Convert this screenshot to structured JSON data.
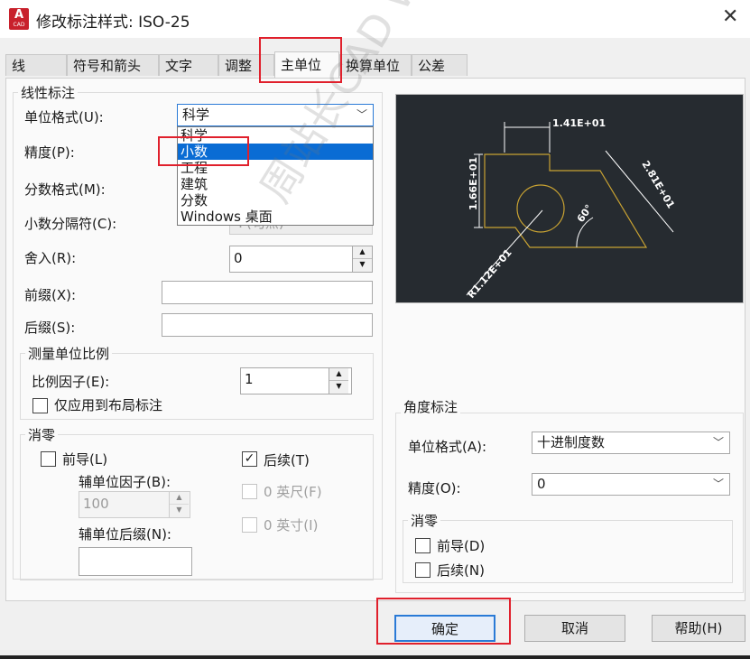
{
  "window": {
    "title": "修改标注样式: ISO-25",
    "app_icon_letter": "A",
    "app_icon_sub": "CAD",
    "close_glyph": "✕"
  },
  "tabs": [
    {
      "label": "线"
    },
    {
      "label": "符号和箭头"
    },
    {
      "label": "文字"
    },
    {
      "label": "调整"
    },
    {
      "label": "主单位"
    },
    {
      "label": "换算单位"
    },
    {
      "label": "公差"
    }
  ],
  "linear": {
    "legend": "线性标注",
    "unit_format_label": "单位格式(U):",
    "unit_format_value": "科学",
    "precision_label": "精度(P):",
    "fraction_label": "分数格式(M):",
    "decimal_sep_label": "小数分隔符(C):",
    "decimal_sep_value": "'.'(句点)",
    "round_label": "舍入(R):",
    "round_value": "0",
    "prefix_label": "前缀(X):",
    "prefix_value": "",
    "suffix_label": "后缀(S):",
    "suffix_value": ""
  },
  "dropdown": {
    "options": [
      "科学",
      "小数",
      "工程",
      "建筑",
      "分数",
      "Windows 桌面"
    ],
    "selected": "小数"
  },
  "scale": {
    "legend": "测量单位比例",
    "factor_label": "比例因子(E):",
    "factor_value": "1",
    "layout_only_label": "仅应用到布局标注"
  },
  "zero_linear": {
    "legend": "消零",
    "leading_label": "前导(L)",
    "trailing_label": "后续(T)",
    "trailing_checked": "✓",
    "sub_factor_label": "辅单位因子(B):",
    "sub_factor_value": "100",
    "sub_suffix_label": "辅单位后缀(N):",
    "feet_label": "0 英尺(F)",
    "inch_label": "0 英寸(I)"
  },
  "angular": {
    "legend": "角度标注",
    "unit_format_label": "单位格式(A):",
    "unit_format_value": "十进制度数",
    "precision_label": "精度(O):",
    "precision_value": "0",
    "zero_legend": "消零",
    "leading_label": "前导(D)",
    "trailing_label": "后续(N)"
  },
  "preview": {
    "dim_top": "1.41E+01",
    "dim_left": "1.66E+01",
    "dim_right": "2.81E+01",
    "dim_radius": "R1.12E+01",
    "angle": "60°"
  },
  "buttons": {
    "ok": "确定",
    "cancel": "取消",
    "help": "帮助(H)"
  },
  "watermark": "周站长CAD  www.zzzcad.com",
  "colors": {
    "highlight": "#e0202c",
    "selection": "#0a6cd4",
    "preview_bg": "#262b30",
    "geometry": "#c8a232"
  }
}
